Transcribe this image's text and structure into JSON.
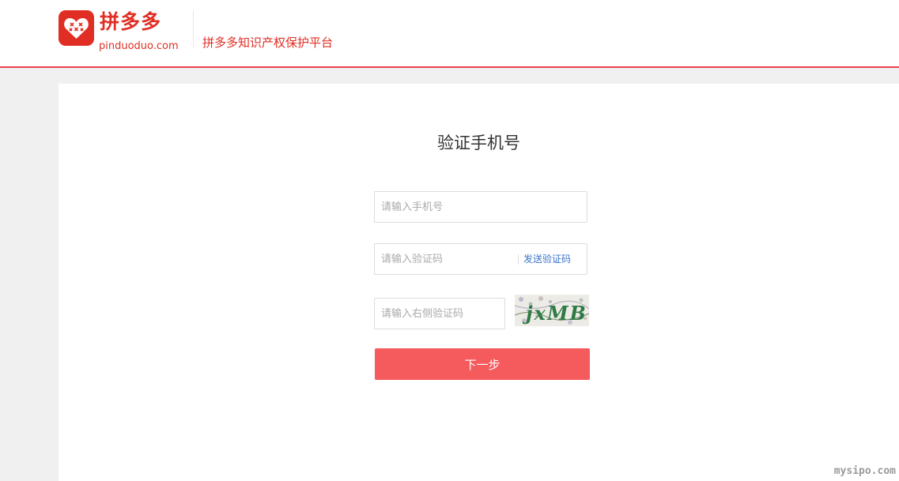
{
  "header": {
    "brand_name": "拼多多",
    "brand_domain": "pinduoduo.com",
    "platform_name": "拼多多知识产权保护平台"
  },
  "form": {
    "title": "验证手机号",
    "phone_placeholder": "请输入手机号",
    "sms_code_placeholder": "请输入验证码",
    "send_code_label": "发送验证码",
    "captcha_placeholder": "请输入右侧验证码",
    "captcha_text": "jxMB",
    "next_label": "下一步"
  },
  "colors": {
    "brand_red": "#e02e24",
    "button_red": "#f55a5d",
    "link_blue": "#3a74c9"
  },
  "icons": {
    "logo": "pinduoduo-heart-logo-icon"
  },
  "watermark": "mysipo.com"
}
